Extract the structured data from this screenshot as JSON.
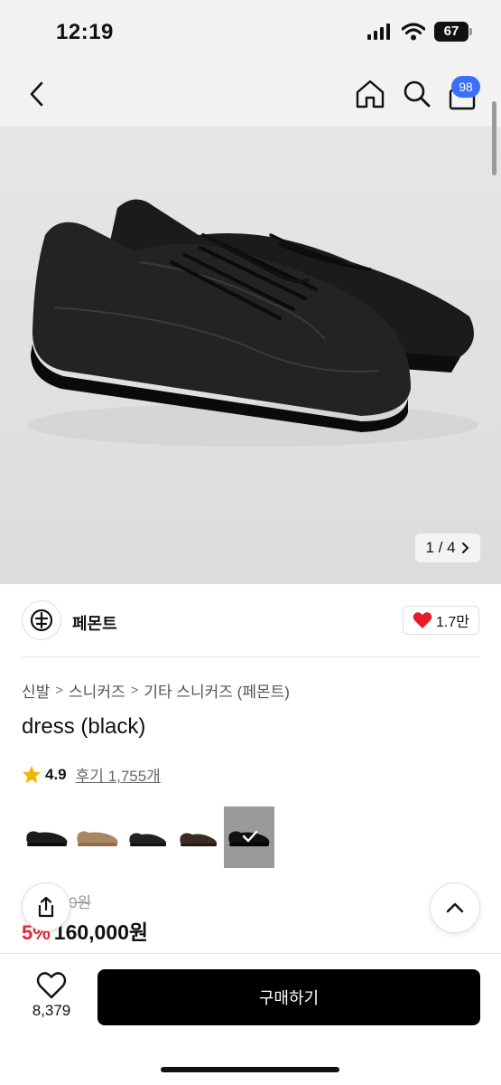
{
  "status_bar": {
    "time": "12:19",
    "battery": "67"
  },
  "navbar": {
    "cart_count": "98"
  },
  "gallery": {
    "counter": "1 / 4"
  },
  "brand": {
    "name": "페몬트",
    "likes": "1.7만"
  },
  "breadcrumb": [
    "신발",
    "스니커즈",
    "기타 스니커즈 (페몬트)"
  ],
  "product": {
    "title": "dress (black)",
    "rating": "4.9",
    "reviews": "후기 1,755개",
    "old_price": "160,000원",
    "discount": "5%",
    "price": "160,000원"
  },
  "thumbnails": [
    {
      "color": "black",
      "swatch": "#1c1c1c"
    },
    {
      "color": "beige",
      "swatch": "#a88763"
    },
    {
      "color": "black",
      "swatch": "#222222"
    },
    {
      "color": "dark brown",
      "swatch": "#3a2b24"
    },
    {
      "color": "black",
      "swatch": "#111111",
      "selected": true
    }
  ],
  "bottom_bar": {
    "wish_count": "8,379",
    "buy_label": "구매하기"
  },
  "colors": {
    "accent": "#3b6ff5",
    "discount": "#e5252e",
    "heart": "#e51b2a"
  }
}
